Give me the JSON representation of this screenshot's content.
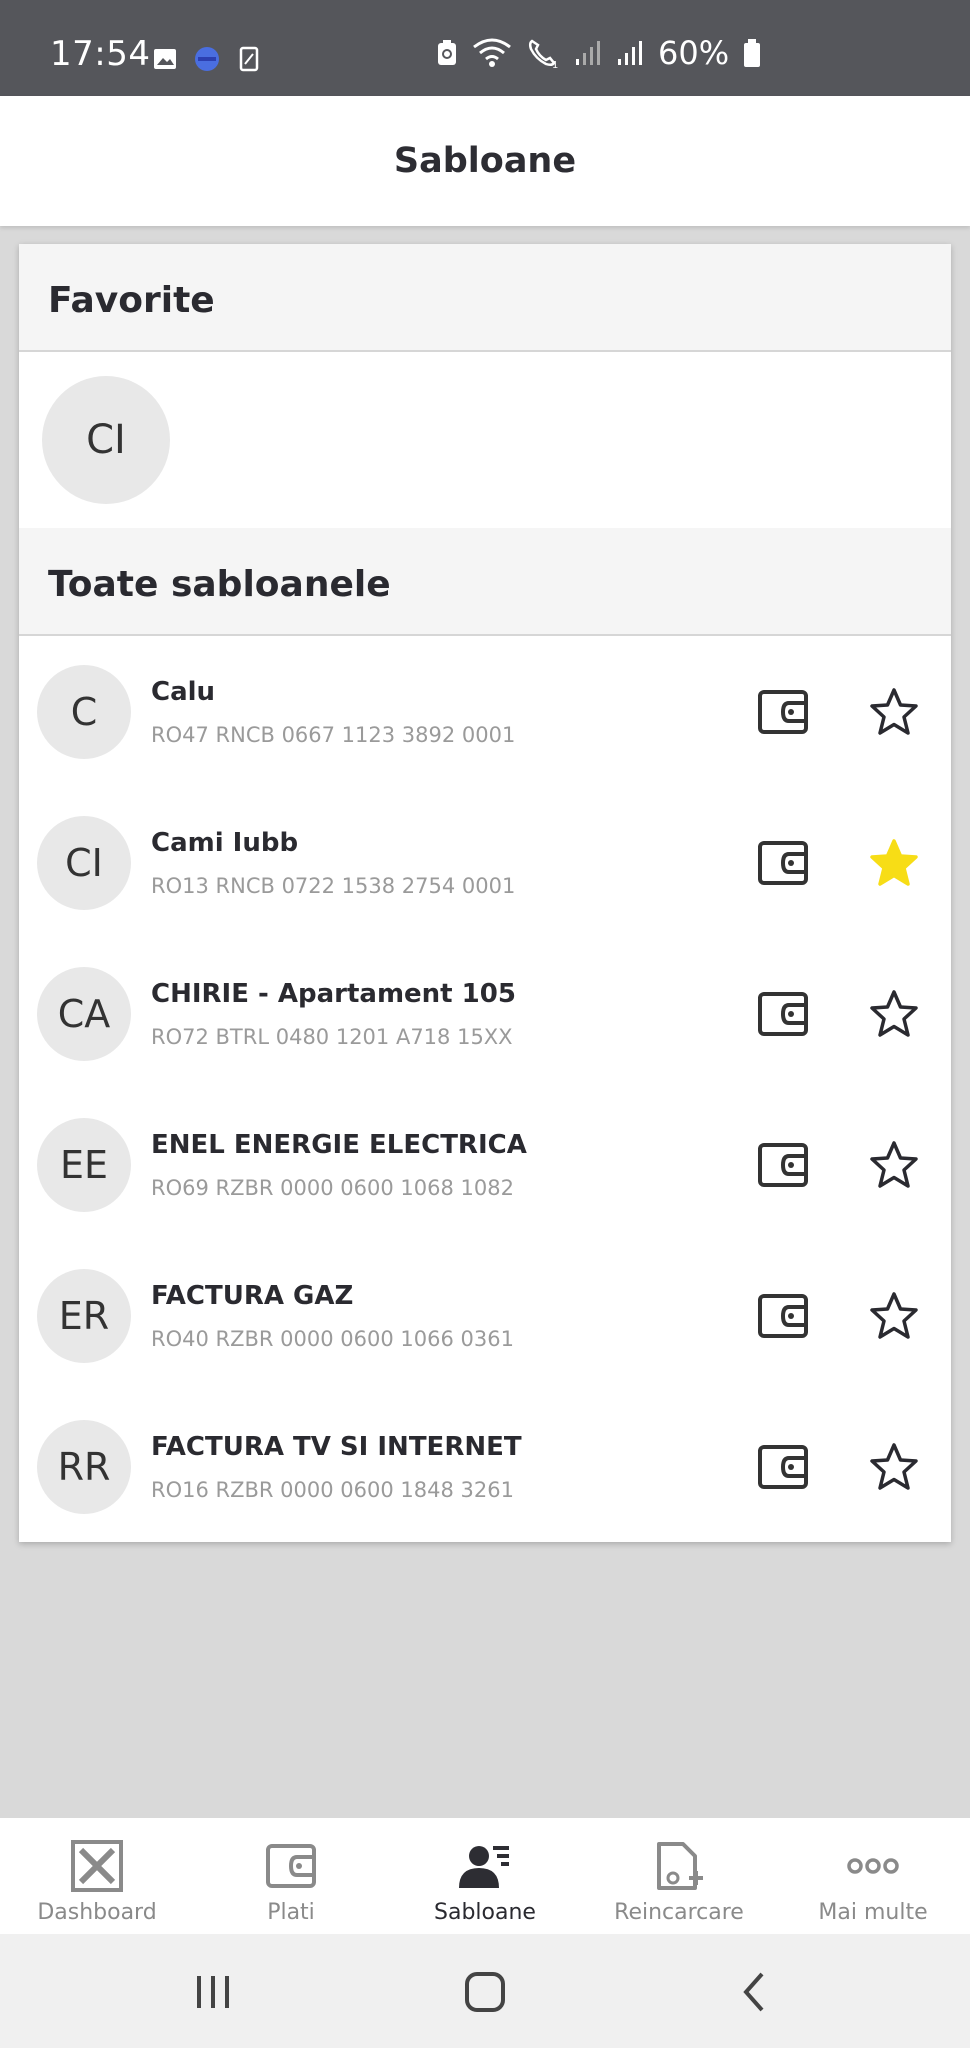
{
  "status_bar": {
    "time": "17:54",
    "battery_percent": "60%",
    "icons": [
      "gallery-icon",
      "messenger-icon",
      "screenshot-icon",
      "battery-saver-icon",
      "wifi-icon",
      "wifi-call-icon",
      "signal-icon",
      "signal-icon",
      "battery-icon"
    ]
  },
  "header": {
    "title": "Sabloane"
  },
  "favorites": {
    "heading": "Favorite",
    "items": [
      {
        "initials": "CI"
      }
    ]
  },
  "templates": {
    "heading": "Toate sabloanele",
    "items": [
      {
        "initials": "C",
        "name": "Calu",
        "iban": "RO47 RNCB 0667 1123 3892 0001",
        "favorite": false
      },
      {
        "initials": "CI",
        "name": "Cami Iubb",
        "iban": "RO13 RNCB 0722 1538 2754 0001",
        "favorite": true
      },
      {
        "initials": "CA",
        "name": "CHIRIE - Apartament 105",
        "iban": "RO72 BTRL 0480 1201 A718 15XX",
        "favorite": false
      },
      {
        "initials": "EE",
        "name": "ENEL ENERGIE ELECTRICA",
        "iban": "RO69 RZBR 0000 0600 1068 1082",
        "favorite": false
      },
      {
        "initials": "ER",
        "name": "FACTURA GAZ",
        "iban": "RO40 RZBR 0000 0600 1066 0361",
        "favorite": false
      },
      {
        "initials": "RR",
        "name": "FACTURA TV SI INTERNET",
        "iban": "RO16 RZBR 0000 0600 1848 3261",
        "favorite": false
      }
    ]
  },
  "bottom_nav": {
    "items": [
      {
        "label": "Dashboard",
        "icon": "dashboard-icon",
        "active": false
      },
      {
        "label": "Plati",
        "icon": "wallet-icon",
        "active": false
      },
      {
        "label": "Sabloane",
        "icon": "templates-icon",
        "active": true
      },
      {
        "label": "Reincarcare",
        "icon": "recharge-icon",
        "active": false
      },
      {
        "label": "Mai multe",
        "icon": "more-icon",
        "active": false
      }
    ]
  },
  "colors": {
    "status_bar": "#55565b",
    "favorite_star": "#f7dd16",
    "avatar_bg": "#e8e8e8",
    "text_dark": "#2a2a30",
    "text_muted": "#9a9a9a"
  }
}
